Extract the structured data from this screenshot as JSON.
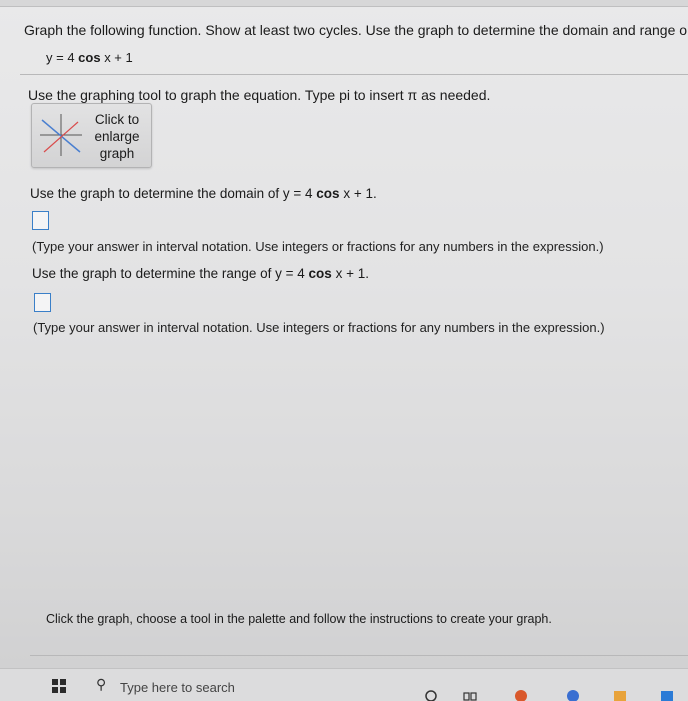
{
  "header": {
    "prompt": "Graph the following function. Show at least two cycles. Use the graph to determine the domain and range o"
  },
  "equation": {
    "lhs": "y = 4 ",
    "cos": "cos",
    "rhs": " x + 1"
  },
  "instructions": {
    "graph_tool": "Use the graphing tool to graph the equation. Type pi to insert π as needed."
  },
  "graph_button": {
    "line1": "Click to",
    "line2": "enlarge",
    "line3": "graph"
  },
  "questions": {
    "domain_prefix": "Use the graph to determine the domain of y = 4 ",
    "domain_cos": "cos",
    "domain_suffix": " x + 1.",
    "domain_hint": "(Type your answer in interval notation. Use integers or fractions for any numbers in the expression.)",
    "range_prefix": "Use the graph to determine the range of y = 4 ",
    "range_cos": "cos",
    "range_suffix": " x + 1.",
    "range_hint": "(Type your answer in interval notation. Use integers or fractions for any numbers in the expression.)"
  },
  "footer": {
    "note": "Click the graph, choose a tool in the palette and follow the instructions to create your graph."
  },
  "taskbar": {
    "search_placeholder": "Type here to search"
  },
  "colors": {
    "answer_box_border": "#3a7fc8",
    "graph_line_blue": "#4a7fd0",
    "graph_line_red": "#d94c4c"
  }
}
